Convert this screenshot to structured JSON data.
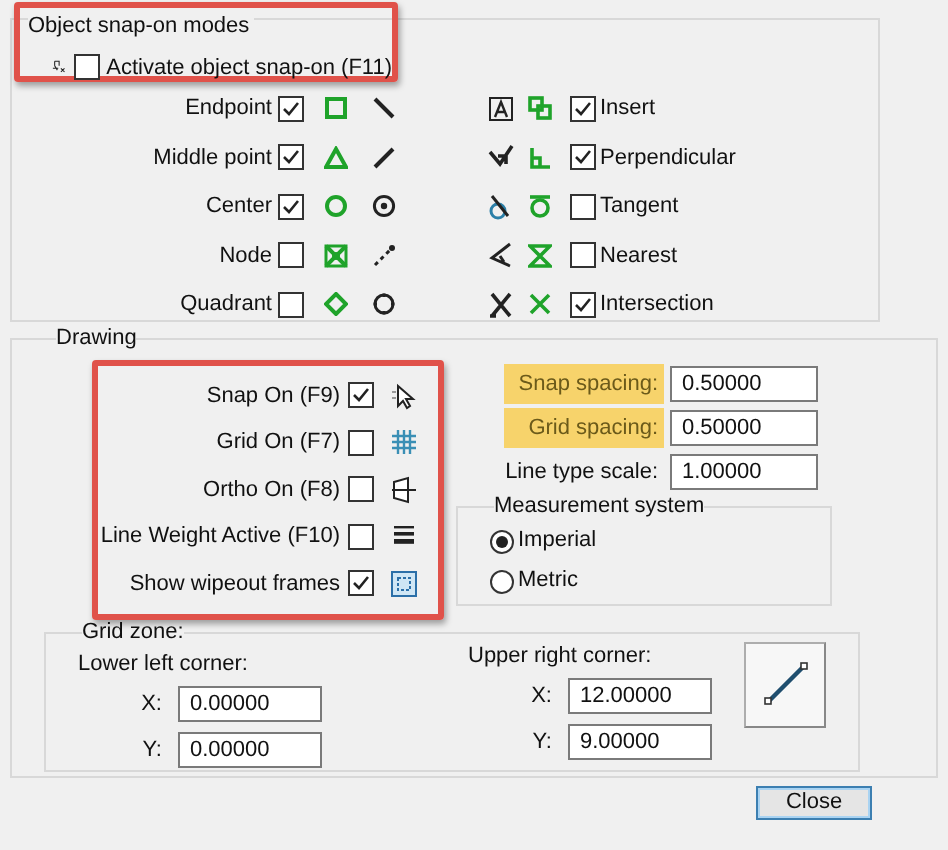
{
  "object_snap": {
    "title": "Object snap-on modes",
    "highlighted": true,
    "activate": {
      "label": "Activate object snap-on (F11)",
      "checked": false
    },
    "left_modes": [
      {
        "label": "Endpoint",
        "checked": true
      },
      {
        "label": "Middle point",
        "checked": true
      },
      {
        "label": "Center",
        "checked": true
      },
      {
        "label": "Node",
        "checked": false
      },
      {
        "label": "Quadrant",
        "checked": false
      }
    ],
    "right_modes": [
      {
        "label": "Insert",
        "checked": true
      },
      {
        "label": "Perpendicular",
        "checked": true
      },
      {
        "label": "Tangent",
        "checked": false
      },
      {
        "label": "Nearest",
        "checked": false
      },
      {
        "label": "Intersection",
        "checked": true
      }
    ]
  },
  "drawing": {
    "title": "Drawing",
    "toggles_highlighted": true,
    "toggles": [
      {
        "label": "Snap On (F9)",
        "checked": true
      },
      {
        "label": "Grid On (F7)",
        "checked": false
      },
      {
        "label": "Ortho On (F8)",
        "checked": false
      },
      {
        "label": "Line Weight Active (F10)",
        "checked": false
      },
      {
        "label": "Show wipeout frames",
        "checked": true
      }
    ],
    "spacing": [
      {
        "label": "Snap spacing:",
        "value": "0.50000",
        "highlighted": true
      },
      {
        "label": "Grid spacing:",
        "value": "0.50000",
        "highlighted": true
      },
      {
        "label": "Line type scale:",
        "value": "1.00000",
        "highlighted": false
      }
    ],
    "measurement": {
      "title": "Measurement system",
      "options": [
        {
          "label": "Imperial",
          "selected": true
        },
        {
          "label": "Metric",
          "selected": false
        }
      ]
    },
    "grid_zone": {
      "title": "Grid zone:",
      "lower_left": {
        "title": "Lower left corner:",
        "fields": [
          {
            "label": "X:",
            "value": "0.00000"
          },
          {
            "label": "Y:",
            "value": "0.00000"
          }
        ]
      },
      "upper_right": {
        "title": "Upper right corner:",
        "fields": [
          {
            "label": "X:",
            "value": "12.00000"
          },
          {
            "label": "Y:",
            "value": "9.00000"
          }
        ]
      }
    }
  },
  "buttons": [
    {
      "label": "Close"
    }
  ]
}
